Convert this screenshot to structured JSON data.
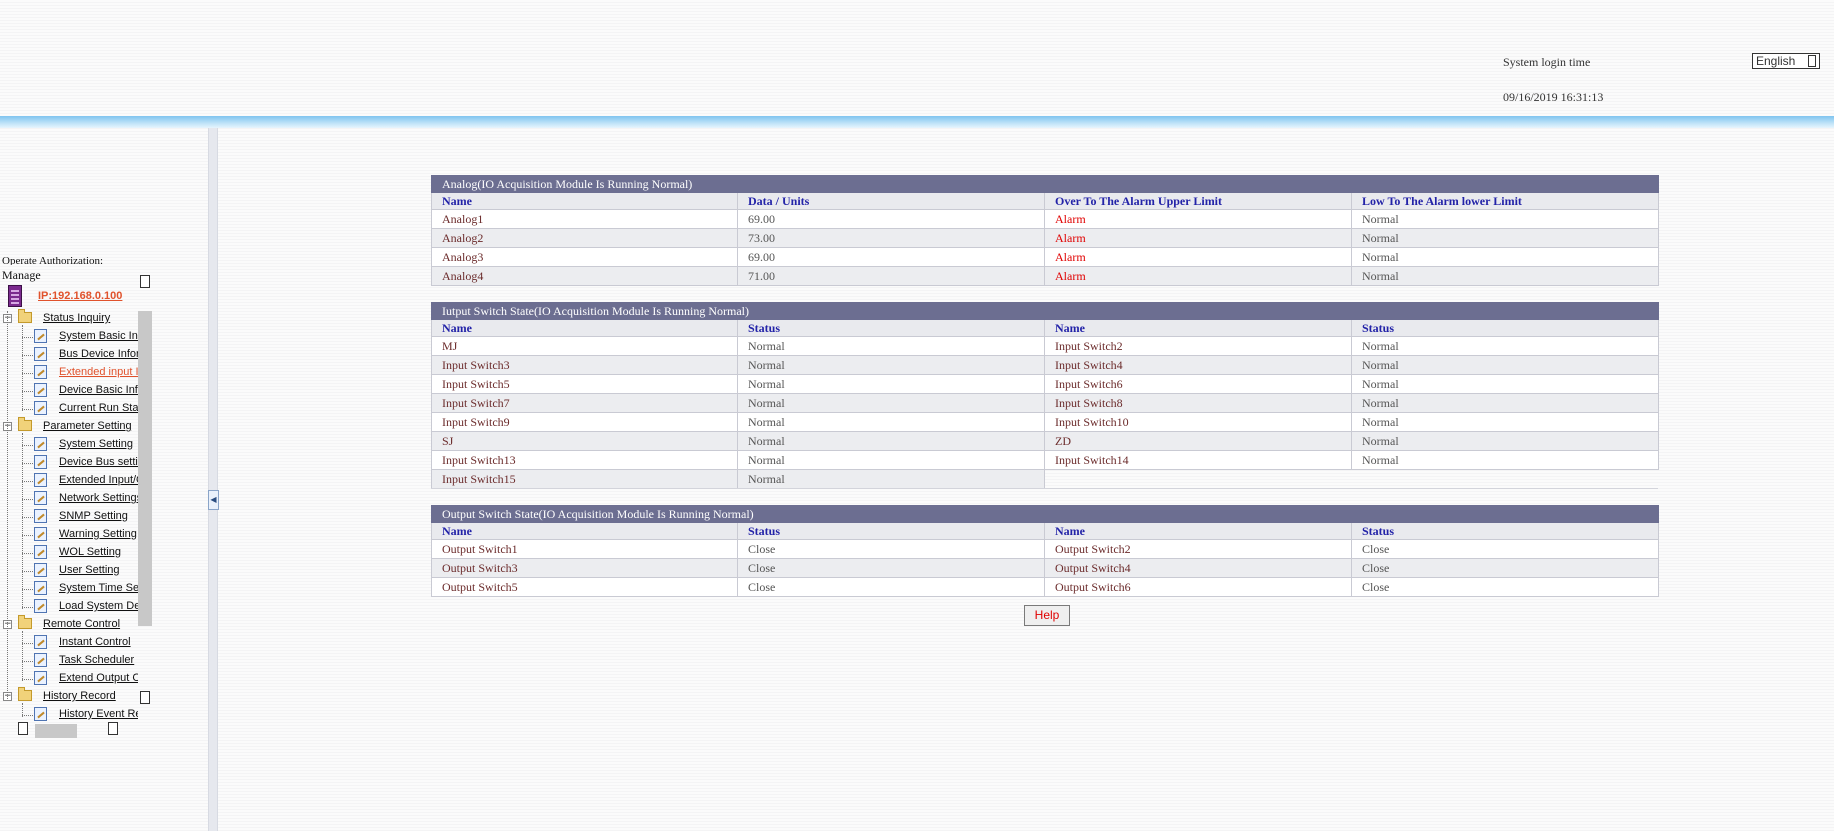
{
  "header": {
    "login_label": "System login time",
    "login_time": "09/16/2019 16:31:13",
    "language": "English"
  },
  "sidebar": {
    "auth_label": "Operate Authorization:",
    "manage_label": "Manage",
    "ip_link": "IP:192.168.0.100",
    "groups": [
      {
        "label": "Status Inquiry",
        "items": [
          "System Basic Info",
          "Bus Device Information",
          "Extended input Information",
          "Device Basic Information",
          "Current Run Status"
        ]
      },
      {
        "label": "Parameter Setting",
        "items": [
          "System Setting",
          "Device Bus setting",
          "Extended Input/Output Setting",
          "Network Settings",
          "SNMP Setting",
          "Warning Setting",
          "WOL Setting",
          "User Setting",
          "System Time Setting",
          "Load System Default"
        ]
      },
      {
        "label": "Remote Control",
        "items": [
          "Instant Control",
          "Task Scheduler",
          "Extend Output Control"
        ]
      },
      {
        "label": "History Record",
        "items": [
          "History Event Record"
        ]
      }
    ]
  },
  "analog": {
    "title": "Analog(IO Acquisition Module Is Running Normal)",
    "headers": [
      "Name",
      "Data / Units",
      "Over To The Alarm Upper Limit",
      "Low To The Alarm lower Limit"
    ],
    "rows": [
      [
        "Analog1",
        "69.00",
        "Alarm",
        "Normal"
      ],
      [
        "Analog2",
        "73.00",
        "Alarm",
        "Normal"
      ],
      [
        "Analog3",
        "69.00",
        "Alarm",
        "Normal"
      ],
      [
        "Analog4",
        "71.00",
        "Alarm",
        "Normal"
      ]
    ]
  },
  "input": {
    "title": "Iutput Switch State(IO Acquisition Module Is Running Normal)",
    "headers": [
      "Name",
      "Status",
      "Name",
      "Status"
    ],
    "rows": [
      [
        "MJ",
        "Normal",
        "Input Switch2",
        "Normal"
      ],
      [
        "Input Switch3",
        "Normal",
        "Input Switch4",
        "Normal"
      ],
      [
        "Input Switch5",
        "Normal",
        "Input Switch6",
        "Normal"
      ],
      [
        "Input Switch7",
        "Normal",
        "Input Switch8",
        "Normal"
      ],
      [
        "Input Switch9",
        "Normal",
        "Input Switch10",
        "Normal"
      ],
      [
        "SJ",
        "Normal",
        "ZD",
        "Normal"
      ],
      [
        "Input Switch13",
        "Normal",
        "Input Switch14",
        "Normal"
      ],
      [
        "Input Switch15",
        "Normal",
        "",
        ""
      ]
    ]
  },
  "output": {
    "title": "Output Switch State(IO Acquisition Module Is Running Normal)",
    "headers": [
      "Name",
      "Status",
      "Name",
      "Status"
    ],
    "rows": [
      [
        "Output Switch1",
        "Close",
        "Output Switch2",
        "Close"
      ],
      [
        "Output Switch3",
        "Close",
        "Output Switch4",
        "Close"
      ],
      [
        "Output Switch5",
        "Close",
        "Output Switch6",
        "Close"
      ]
    ]
  },
  "help_label": "Help",
  "colors": {
    "title_bar": "#6c6e91",
    "header_text": "#2323a8",
    "alarm": "#e00000",
    "link": "#e0522c"
  }
}
